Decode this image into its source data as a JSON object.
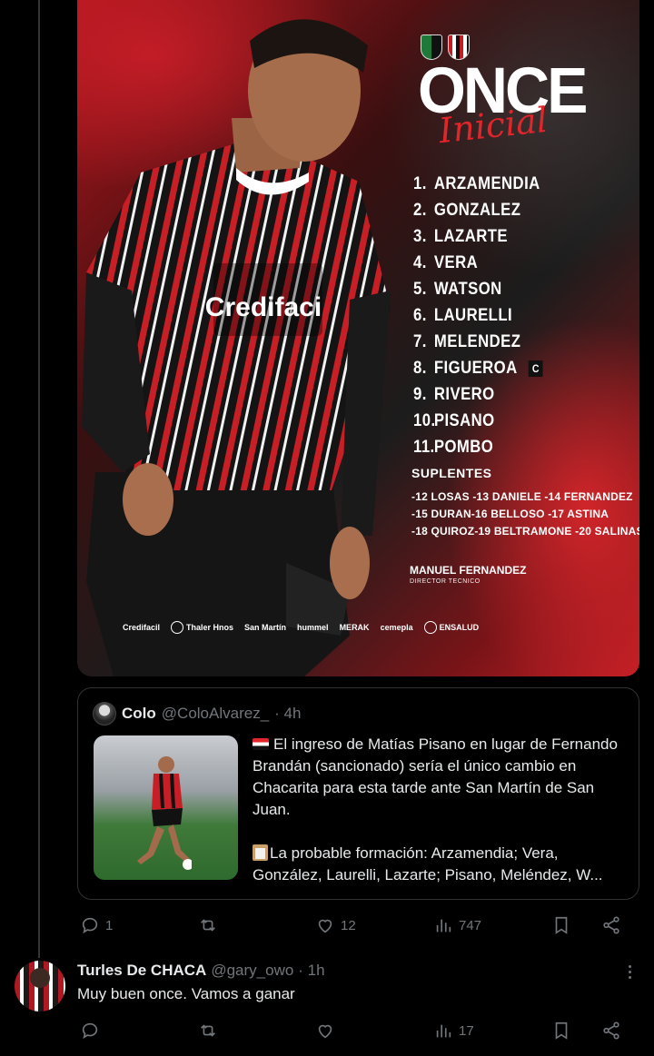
{
  "poster": {
    "title": "ONCE",
    "subtitle": "Inicial",
    "lineup": [
      {
        "num": "1.",
        "name": "ARZAMENDIA"
      },
      {
        "num": "2.",
        "name": "GONZALEZ"
      },
      {
        "num": "3.",
        "name": "LAZARTE"
      },
      {
        "num": "4.",
        "name": "VERA"
      },
      {
        "num": "5.",
        "name": "WATSON"
      },
      {
        "num": "6.",
        "name": "LAURELLI"
      },
      {
        "num": "7.",
        "name": "MELENDEZ"
      },
      {
        "num": "8.",
        "name": "FIGUEROA"
      },
      {
        "num": "9.",
        "name": "RIVERO"
      },
      {
        "num": "10.",
        "name": "PISANO"
      },
      {
        "num": "11.",
        "name": "POMBO"
      }
    ],
    "captain_badge": "C",
    "subs_title": "SUPLENTES",
    "subs": [
      "-12 LOSAS -13 DANIELE -14 FERNANDEZ",
      "-15 DURAN-16 BELLOSO -17 ASTINA",
      "-18 QUIROZ-19 BELTRAMONE -20 SALINAS"
    ],
    "coach_name": "MANUEL FERNANDEZ",
    "coach_role": "DIRECTOR TECNICO",
    "sponsors": [
      "Credifacil",
      "Thaler Hnos",
      "San Martín",
      "hummel",
      "MERAK",
      "cemepla",
      "ENSALUD"
    ],
    "shirt_text": "Credifaci"
  },
  "quote": {
    "name": "Colo",
    "handle": "@ColoAlvarez_",
    "time": "· 4h",
    "paragraph1": "El ingreso de Matías Pisano en lugar de Fernando Brandán (sancionado) sería el único cambio en Chacarita para esta tarde ante San Martín de San Juan.",
    "paragraph2": "La probable formación: Arzamendia; Vera, González, Laurelli, Lazarte; Pisano, Meléndez, W..."
  },
  "main_actions": {
    "replies": "1",
    "retweets": "",
    "likes": "12",
    "views": "747"
  },
  "reply": {
    "name": "Turles De CHACA",
    "handle": "@gary_owo",
    "time": "· 1h",
    "text": "Muy buen once. Vamos a ganar"
  },
  "reply_actions": {
    "replies": "",
    "retweets": "",
    "likes": "",
    "views": "17"
  },
  "colors": {
    "background": "#000000",
    "text": "#e7e9ea",
    "muted": "#71767b",
    "border": "#2f3336",
    "accent_red": "#e0262b"
  }
}
